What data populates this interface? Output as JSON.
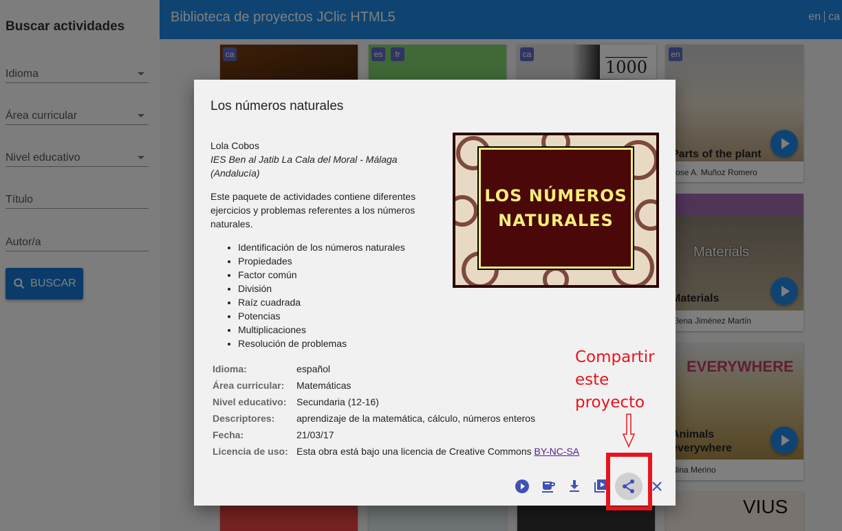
{
  "sidebar": {
    "heading": "Buscar actividades",
    "idioma_label": "Idioma",
    "area_label": "Área curricular",
    "nivel_label": "Nivel educativo",
    "titulo_label": "Título",
    "autor_label": "Autor/a",
    "search_button": "BUSCAR"
  },
  "header": {
    "title": "Biblioteca de proyectos JClic HTML5",
    "lang_en": "en",
    "lang_ca": "ca"
  },
  "cards": [
    {
      "lang": "ca"
    },
    {
      "lang": "es",
      "lang2": "fr"
    },
    {
      "lang": "ca"
    },
    {
      "math_text": "1000"
    },
    {
      "lang": "en",
      "title": "Parts of the plant",
      "author": "Jose A. Muñoz Romero"
    },
    {
      "title": "Materials",
      "author": "Elena Jiménez Martín",
      "img_text": "Materials"
    },
    {
      "title": "Animals everywhere",
      "author": "Nina Merino",
      "img_text": "EVERYWHERE"
    },
    {
      "img_text": "VIUS"
    }
  ],
  "dialog": {
    "title": "Los números naturales",
    "author": "Lola Cobos",
    "school": "IES Ben al Jatib La Cala del Moral - Málaga (Andalucía)",
    "description": "Este paquete de actividades contiene diferentes ejercicios y problemas referentes a los números naturales.",
    "topics": [
      "Identificación de los números naturales",
      "Propiedades",
      "Factor común",
      "División",
      "Raíz cuadrada",
      "Potencias",
      "Multiplicaciones",
      "Resolución de problemas"
    ],
    "cover_line1": "LOS NÚMEROS",
    "cover_line2": "NATURALES",
    "meta": {
      "idioma_key": "Idioma:",
      "idioma_val": "español",
      "area_key": "Área curricular:",
      "area_val": "Matemáticas",
      "nivel_key": "Nivel educativo:",
      "nivel_val": "Secundaria (12-16)",
      "desc_key": "Descriptores:",
      "desc_val": "aprendizaje de la matemática, cálculo, números enteros",
      "fecha_key": "Fecha:",
      "fecha_val": "21/03/17",
      "lic_key": "Licencia de uso:",
      "lic_val": "Esta obra está bajo una licencia de Creative Commons",
      "lic_link": "BY-NC-SA"
    },
    "actions": [
      "play-icon",
      "embed-icon",
      "download-icon",
      "preview-icon",
      "share-icon",
      "close-icon"
    ]
  },
  "annotation": {
    "line1": "Compartir",
    "line2": "este",
    "line3": "proyecto",
    "color": "#e8141c"
  },
  "colors": {
    "header_blue": "#1e88e5",
    "button_blue": "#1976d2",
    "chip_indigo": "#5c6bc0",
    "action_icon": "#3f51b5"
  }
}
